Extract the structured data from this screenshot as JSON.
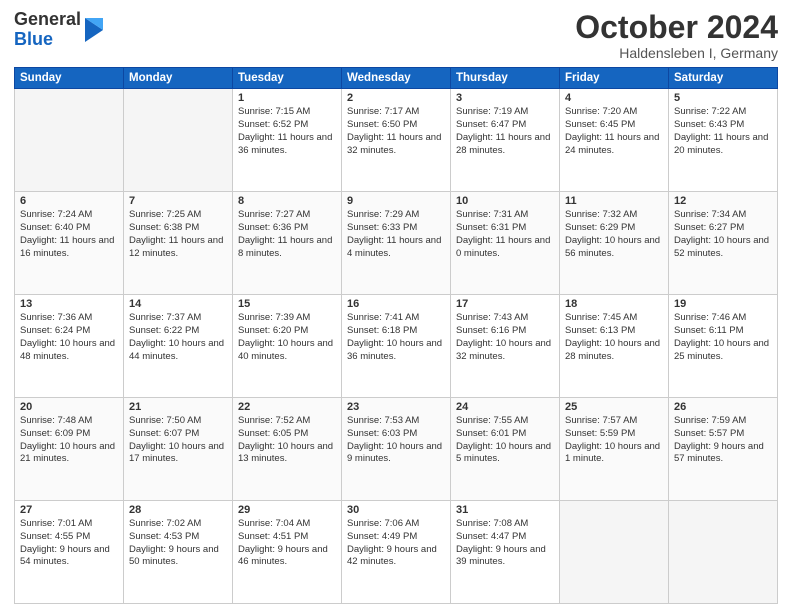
{
  "header": {
    "logo_general": "General",
    "logo_blue": "Blue",
    "month_title": "October 2024",
    "location": "Haldensleben I, Germany"
  },
  "weekdays": [
    "Sunday",
    "Monday",
    "Tuesday",
    "Wednesday",
    "Thursday",
    "Friday",
    "Saturday"
  ],
  "weeks": [
    [
      {
        "day": "",
        "empty": true
      },
      {
        "day": "",
        "empty": true
      },
      {
        "day": "1",
        "sunrise": "7:15 AM",
        "sunset": "6:52 PM",
        "daylight": "11 hours and 36 minutes."
      },
      {
        "day": "2",
        "sunrise": "7:17 AM",
        "sunset": "6:50 PM",
        "daylight": "11 hours and 32 minutes."
      },
      {
        "day": "3",
        "sunrise": "7:19 AM",
        "sunset": "6:47 PM",
        "daylight": "11 hours and 28 minutes."
      },
      {
        "day": "4",
        "sunrise": "7:20 AM",
        "sunset": "6:45 PM",
        "daylight": "11 hours and 24 minutes."
      },
      {
        "day": "5",
        "sunrise": "7:22 AM",
        "sunset": "6:43 PM",
        "daylight": "11 hours and 20 minutes."
      }
    ],
    [
      {
        "day": "6",
        "sunrise": "7:24 AM",
        "sunset": "6:40 PM",
        "daylight": "11 hours and 16 minutes."
      },
      {
        "day": "7",
        "sunrise": "7:25 AM",
        "sunset": "6:38 PM",
        "daylight": "11 hours and 12 minutes."
      },
      {
        "day": "8",
        "sunrise": "7:27 AM",
        "sunset": "6:36 PM",
        "daylight": "11 hours and 8 minutes."
      },
      {
        "day": "9",
        "sunrise": "7:29 AM",
        "sunset": "6:33 PM",
        "daylight": "11 hours and 4 minutes."
      },
      {
        "day": "10",
        "sunrise": "7:31 AM",
        "sunset": "6:31 PM",
        "daylight": "11 hours and 0 minutes."
      },
      {
        "day": "11",
        "sunrise": "7:32 AM",
        "sunset": "6:29 PM",
        "daylight": "10 hours and 56 minutes."
      },
      {
        "day": "12",
        "sunrise": "7:34 AM",
        "sunset": "6:27 PM",
        "daylight": "10 hours and 52 minutes."
      }
    ],
    [
      {
        "day": "13",
        "sunrise": "7:36 AM",
        "sunset": "6:24 PM",
        "daylight": "10 hours and 48 minutes."
      },
      {
        "day": "14",
        "sunrise": "7:37 AM",
        "sunset": "6:22 PM",
        "daylight": "10 hours and 44 minutes."
      },
      {
        "day": "15",
        "sunrise": "7:39 AM",
        "sunset": "6:20 PM",
        "daylight": "10 hours and 40 minutes."
      },
      {
        "day": "16",
        "sunrise": "7:41 AM",
        "sunset": "6:18 PM",
        "daylight": "10 hours and 36 minutes."
      },
      {
        "day": "17",
        "sunrise": "7:43 AM",
        "sunset": "6:16 PM",
        "daylight": "10 hours and 32 minutes."
      },
      {
        "day": "18",
        "sunrise": "7:45 AM",
        "sunset": "6:13 PM",
        "daylight": "10 hours and 28 minutes."
      },
      {
        "day": "19",
        "sunrise": "7:46 AM",
        "sunset": "6:11 PM",
        "daylight": "10 hours and 25 minutes."
      }
    ],
    [
      {
        "day": "20",
        "sunrise": "7:48 AM",
        "sunset": "6:09 PM",
        "daylight": "10 hours and 21 minutes."
      },
      {
        "day": "21",
        "sunrise": "7:50 AM",
        "sunset": "6:07 PM",
        "daylight": "10 hours and 17 minutes."
      },
      {
        "day": "22",
        "sunrise": "7:52 AM",
        "sunset": "6:05 PM",
        "daylight": "10 hours and 13 minutes."
      },
      {
        "day": "23",
        "sunrise": "7:53 AM",
        "sunset": "6:03 PM",
        "daylight": "10 hours and 9 minutes."
      },
      {
        "day": "24",
        "sunrise": "7:55 AM",
        "sunset": "6:01 PM",
        "daylight": "10 hours and 5 minutes."
      },
      {
        "day": "25",
        "sunrise": "7:57 AM",
        "sunset": "5:59 PM",
        "daylight": "10 hours and 1 minute."
      },
      {
        "day": "26",
        "sunrise": "7:59 AM",
        "sunset": "5:57 PM",
        "daylight": "9 hours and 57 minutes."
      }
    ],
    [
      {
        "day": "27",
        "sunrise": "7:01 AM",
        "sunset": "4:55 PM",
        "daylight": "9 hours and 54 minutes."
      },
      {
        "day": "28",
        "sunrise": "7:02 AM",
        "sunset": "4:53 PM",
        "daylight": "9 hours and 50 minutes."
      },
      {
        "day": "29",
        "sunrise": "7:04 AM",
        "sunset": "4:51 PM",
        "daylight": "9 hours and 46 minutes."
      },
      {
        "day": "30",
        "sunrise": "7:06 AM",
        "sunset": "4:49 PM",
        "daylight": "9 hours and 42 minutes."
      },
      {
        "day": "31",
        "sunrise": "7:08 AM",
        "sunset": "4:47 PM",
        "daylight": "9 hours and 39 minutes."
      },
      {
        "day": "",
        "empty": true
      },
      {
        "day": "",
        "empty": true
      }
    ]
  ]
}
